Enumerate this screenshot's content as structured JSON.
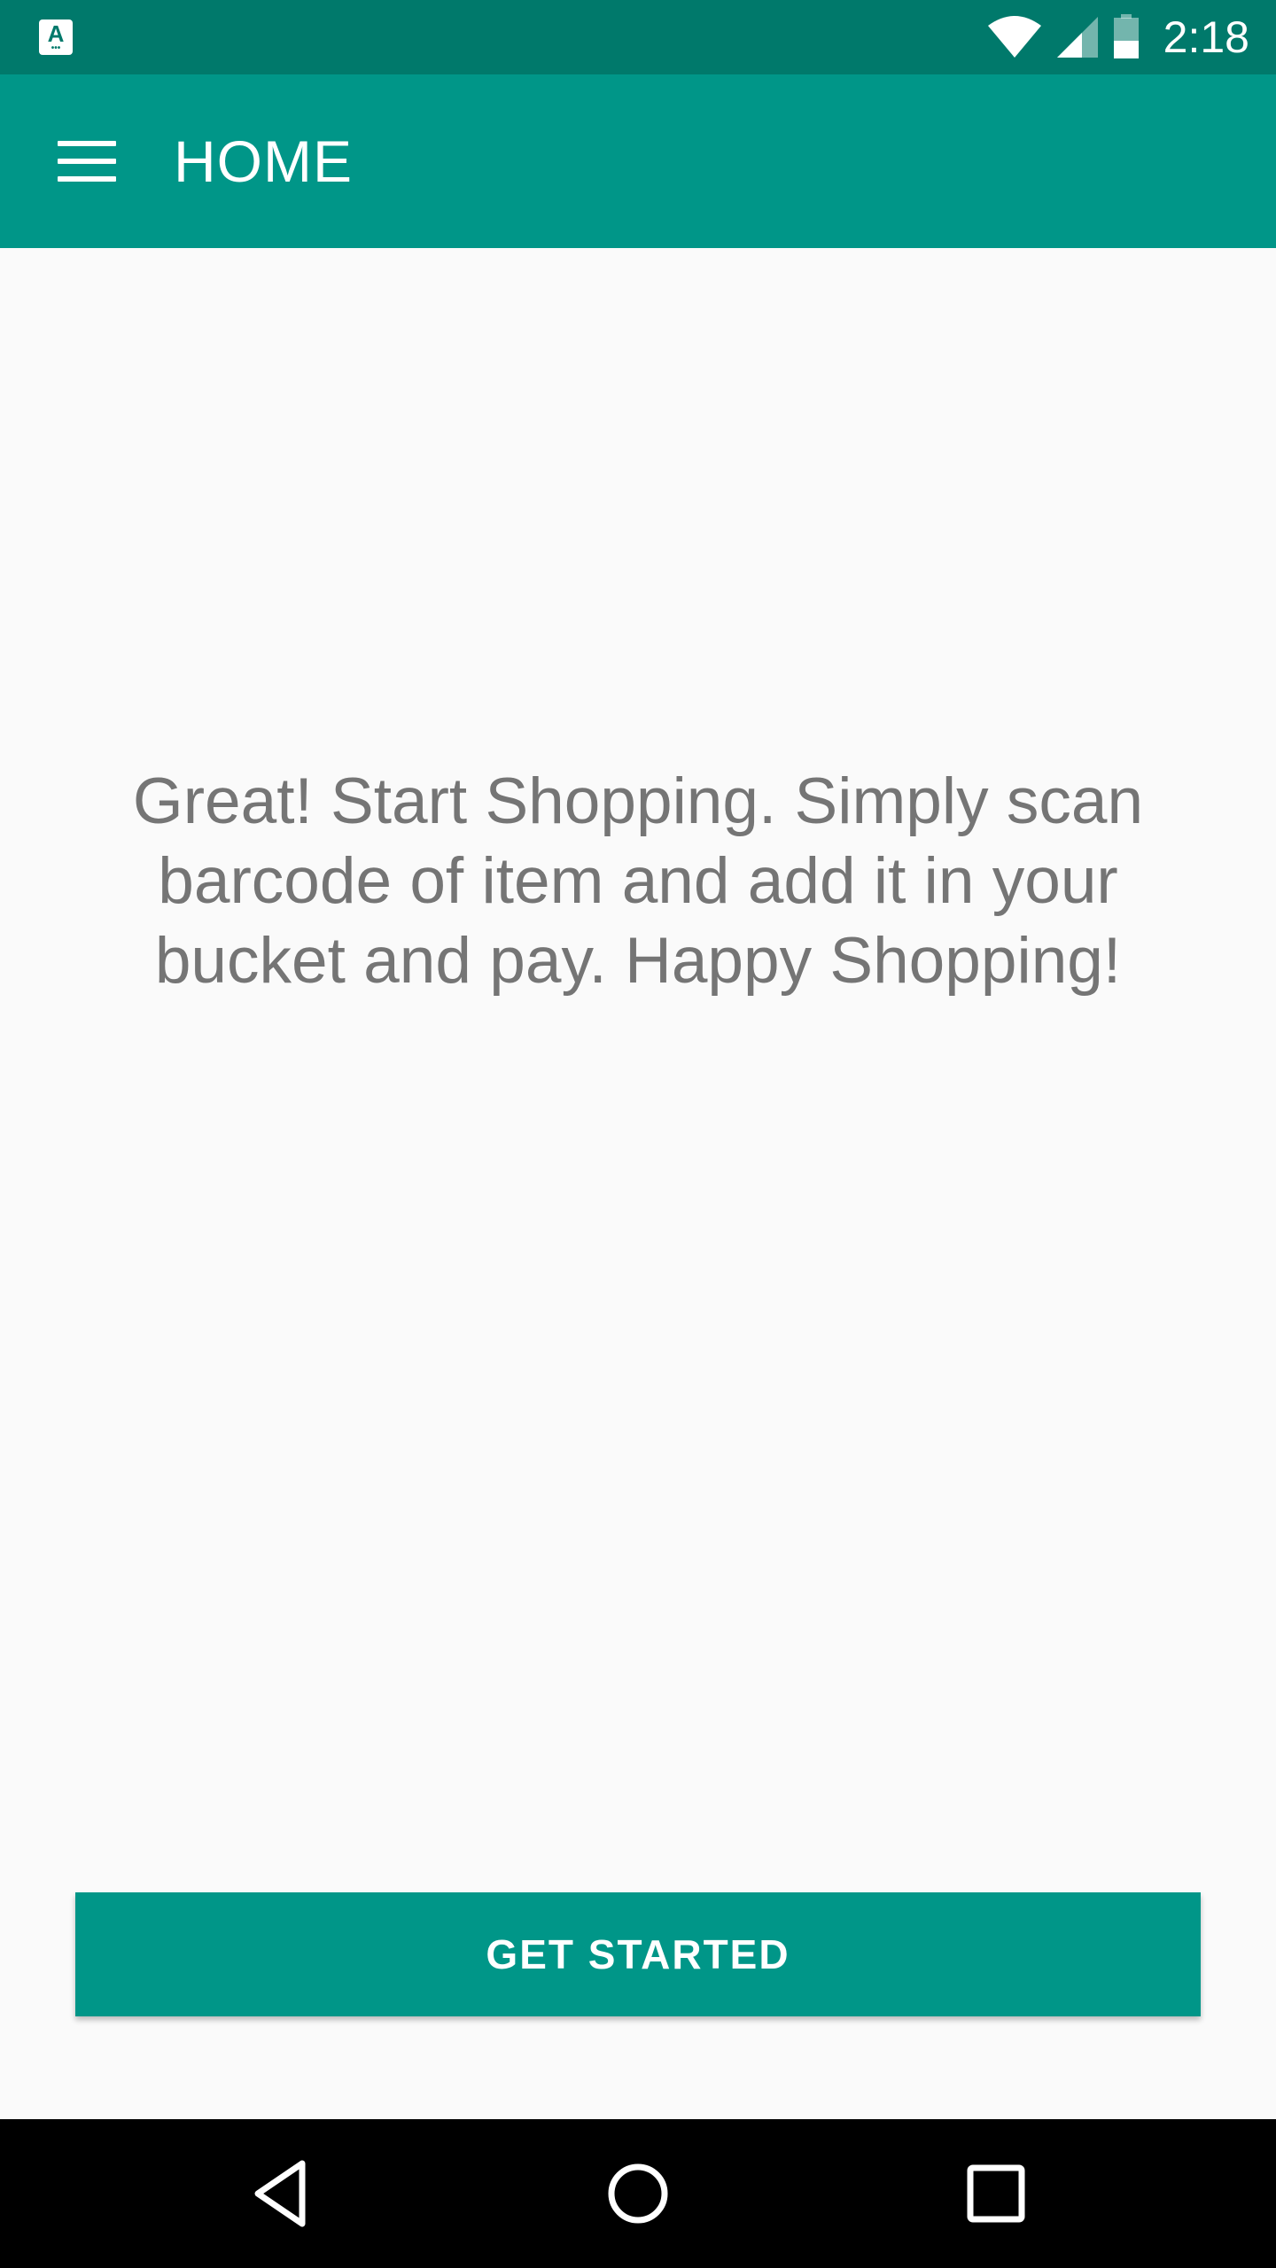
{
  "status_bar": {
    "app_icon_letter": "A",
    "time": "2:18",
    "icons": [
      "wifi-icon",
      "cell-signal-icon",
      "battery-icon"
    ]
  },
  "app_bar": {
    "menu_icon": "hamburger-menu-icon",
    "title": "HOME"
  },
  "main": {
    "message": "Great! Start Shopping. Simply scan barcode of item and add it in your bucket and pay. Happy Shopping!"
  },
  "actions": {
    "get_started_label": "GET STARTED"
  },
  "nav_bar": {
    "buttons": [
      "back-icon",
      "home-icon",
      "recents-icon"
    ]
  },
  "colors": {
    "primary": "#009688",
    "primary_dark": "#00796b",
    "background": "#fafafa",
    "message_text": "#757575"
  }
}
